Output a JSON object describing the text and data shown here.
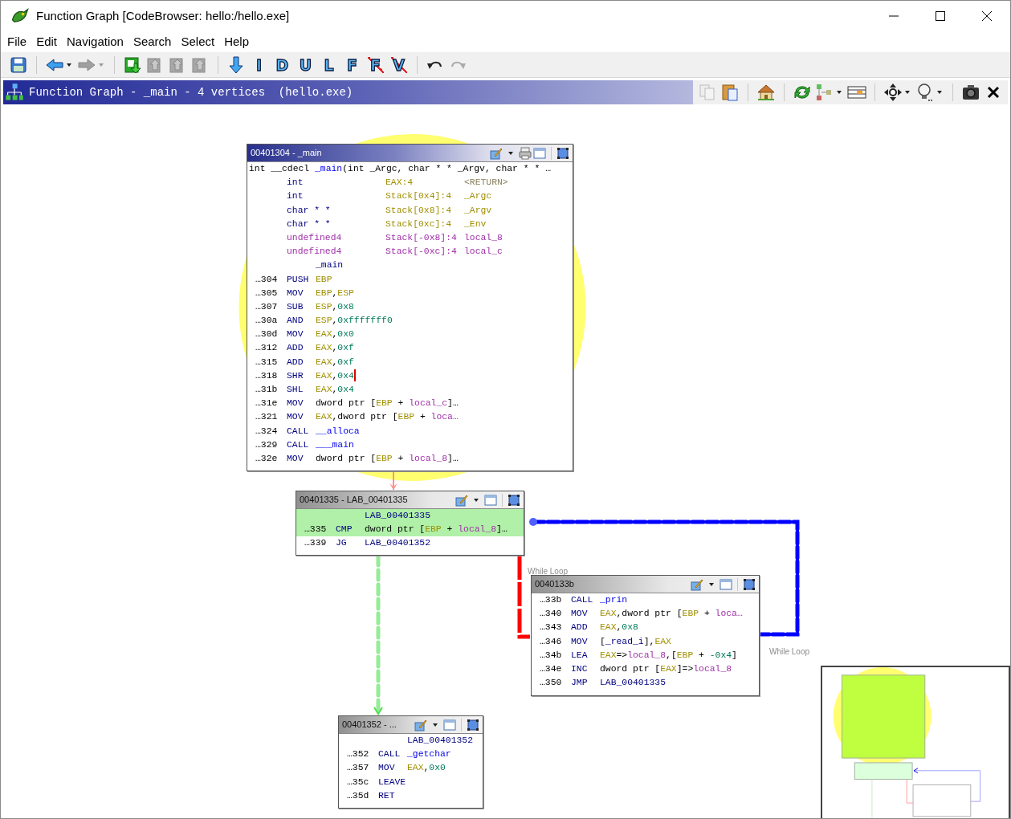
{
  "window": {
    "title": "Function Graph [CodeBrowser: hello:/hello.exe]"
  },
  "menu": [
    "File",
    "Edit",
    "Navigation",
    "Search",
    "Select",
    "Help"
  ],
  "toolbar": {
    "letter_buttons": [
      {
        "label": "I",
        "crossed": false
      },
      {
        "label": "D",
        "crossed": false
      },
      {
        "label": "U",
        "crossed": false
      },
      {
        "label": "L",
        "crossed": false
      },
      {
        "label": "F",
        "crossed": false
      },
      {
        "label": "F",
        "crossed": true
      },
      {
        "label": "V",
        "crossed": true
      }
    ]
  },
  "panel": {
    "title": "Function Graph - _main - 4 vertices  (hello.exe)"
  },
  "blocks": [
    {
      "title": "00401304 - _main",
      "focused": true,
      "lines": [
        {
          "kind": "signature",
          "tokens": [
            {
              "kind": "text",
              "text": "int __cdecl "
            },
            {
              "kind": "func",
              "text": "_main"
            },
            {
              "kind": "text",
              "text": "(int _Argc, char * * _Argv, char * * …"
            }
          ]
        },
        {
          "kind": "return_param",
          "type": "int",
          "storage": "EAX:4",
          "name": "<RETURN>"
        },
        {
          "kind": "param",
          "type": "int",
          "storage": "Stack[0x4]:4",
          "name": "_Argc"
        },
        {
          "kind": "param",
          "type": "char * *",
          "storage": "Stack[0x8]:4",
          "name": "_Argv"
        },
        {
          "kind": "param",
          "type": "char * *",
          "storage": "Stack[0xc]:4",
          "name": "_Env"
        },
        {
          "kind": "local",
          "type": "undefined4",
          "storage": "Stack[-0x8]:4",
          "name": "local_8"
        },
        {
          "kind": "local",
          "type": "undefined4",
          "storage": "Stack[-0xc]:4",
          "name": "local_c"
        },
        {
          "kind": "label",
          "text": "_main"
        },
        {
          "kind": "instr",
          "addr": "…304",
          "mnemonic": "PUSH",
          "ops": [
            {
              "kind": "reg",
              "text": "EBP"
            }
          ]
        },
        {
          "kind": "instr",
          "addr": "…305",
          "mnemonic": "MOV",
          "ops": [
            {
              "kind": "reg",
              "text": "EBP"
            },
            {
              "kind": "text",
              "text": ","
            },
            {
              "kind": "reg",
              "text": "ESP"
            }
          ]
        },
        {
          "kind": "instr",
          "addr": "…307",
          "mnemonic": "SUB",
          "ops": [
            {
              "kind": "reg",
              "text": "ESP"
            },
            {
              "kind": "text",
              "text": ","
            },
            {
              "kind": "num",
              "text": "0x8"
            }
          ]
        },
        {
          "kind": "instr",
          "addr": "…30a",
          "mnemonic": "AND",
          "ops": [
            {
              "kind": "reg",
              "text": "ESP"
            },
            {
              "kind": "text",
              "text": ","
            },
            {
              "kind": "num",
              "text": "0xfffffff0"
            }
          ]
        },
        {
          "kind": "instr",
          "addr": "…30d",
          "mnemonic": "MOV",
          "ops": [
            {
              "kind": "reg",
              "text": "EAX"
            },
            {
              "kind": "text",
              "text": ","
            },
            {
              "kind": "num",
              "text": "0x0"
            }
          ]
        },
        {
          "kind": "instr",
          "addr": "…312",
          "mnemonic": "ADD",
          "ops": [
            {
              "kind": "reg",
              "text": "EAX"
            },
            {
              "kind": "text",
              "text": ","
            },
            {
              "kind": "num",
              "text": "0xf"
            }
          ]
        },
        {
          "kind": "instr",
          "addr": "…315",
          "mnemonic": "ADD",
          "ops": [
            {
              "kind": "reg",
              "text": "EAX"
            },
            {
              "kind": "text",
              "text": ","
            },
            {
              "kind": "num",
              "text": "0xf"
            }
          ]
        },
        {
          "kind": "instr",
          "addr": "…318",
          "mnemonic": "SHR",
          "ops": [
            {
              "kind": "reg",
              "text": "EAX"
            },
            {
              "kind": "text",
              "text": ","
            },
            {
              "kind": "num",
              "text": "0x4"
            }
          ],
          "cursor": true
        },
        {
          "kind": "instr",
          "addr": "…31b",
          "mnemonic": "SHL",
          "ops": [
            {
              "kind": "reg",
              "text": "EAX"
            },
            {
              "kind": "text",
              "text": ","
            },
            {
              "kind": "num",
              "text": "0x4"
            }
          ]
        },
        {
          "kind": "instr",
          "addr": "…31e",
          "mnemonic": "MOV",
          "ops": [
            {
              "kind": "text",
              "text": "dword ptr ["
            },
            {
              "kind": "reg",
              "text": "EBP"
            },
            {
              "kind": "text",
              "text": " + "
            },
            {
              "kind": "var",
              "text": "local_c"
            },
            {
              "kind": "text",
              "text": "]…"
            }
          ]
        },
        {
          "kind": "instr",
          "addr": "…321",
          "mnemonic": "MOV",
          "ops": [
            {
              "kind": "reg",
              "text": "EAX"
            },
            {
              "kind": "text",
              "text": ",dword ptr ["
            },
            {
              "kind": "reg",
              "text": "EBP"
            },
            {
              "kind": "text",
              "text": " + "
            },
            {
              "kind": "var",
              "text": "loca…"
            }
          ]
        },
        {
          "kind": "instr",
          "addr": "…324",
          "mnemonic": "CALL",
          "ops": [
            {
              "kind": "func",
              "text": "__alloca"
            }
          ]
        },
        {
          "kind": "instr",
          "addr": "…329",
          "mnemonic": "CALL",
          "ops": [
            {
              "kind": "func",
              "text": "___main"
            }
          ]
        },
        {
          "kind": "instr",
          "addr": "…32e",
          "mnemonic": "MOV",
          "ops": [
            {
              "kind": "text",
              "text": "dword ptr ["
            },
            {
              "kind": "reg",
              "text": "EBP"
            },
            {
              "kind": "text",
              "text": " + "
            },
            {
              "kind": "var",
              "text": "local_8"
            },
            {
              "kind": "text",
              "text": "]…"
            }
          ]
        }
      ]
    },
    {
      "title": "00401335 - LAB_00401335",
      "focused": false,
      "lines": [
        {
          "kind": "label",
          "text": "LAB_00401335",
          "highlighted": true
        },
        {
          "kind": "instr",
          "addr": "…335",
          "mnemonic": "CMP",
          "ops": [
            {
              "kind": "text",
              "text": "dword ptr ["
            },
            {
              "kind": "reg",
              "text": "EBP"
            },
            {
              "kind": "text",
              "text": " + "
            },
            {
              "kind": "var",
              "text": "local_8"
            },
            {
              "kind": "text",
              "text": "]…"
            }
          ],
          "highlighted": true
        },
        {
          "kind": "instr",
          "addr": "…339",
          "mnemonic": "JG",
          "ops": [
            {
              "kind": "label",
              "text": "LAB_00401352"
            }
          ],
          "highlighted": false
        }
      ]
    },
    {
      "title": "0040133b",
      "focused": false,
      "lines": [
        {
          "kind": "instr",
          "addr": "…33b",
          "mnemonic": "CALL",
          "ops": [
            {
              "kind": "func",
              "text": "_prin"
            }
          ]
        },
        {
          "kind": "instr",
          "addr": "…340",
          "mnemonic": "MOV",
          "ops": [
            {
              "kind": "reg",
              "text": "EAX"
            },
            {
              "kind": "text",
              "text": ",dword ptr ["
            },
            {
              "kind": "reg",
              "text": "EBP"
            },
            {
              "kind": "text",
              "text": " + "
            },
            {
              "kind": "var",
              "text": "loca…"
            }
          ]
        },
        {
          "kind": "instr",
          "addr": "…343",
          "mnemonic": "ADD",
          "ops": [
            {
              "kind": "reg",
              "text": "EAX"
            },
            {
              "kind": "text",
              "text": ","
            },
            {
              "kind": "num",
              "text": "0x8"
            }
          ]
        },
        {
          "kind": "instr",
          "addr": "…346",
          "mnemonic": "MOV",
          "ops": [
            {
              "kind": "text",
              "text": "["
            },
            {
              "kind": "label",
              "text": "_read_i"
            },
            {
              "kind": "text",
              "text": "],"
            },
            {
              "kind": "reg",
              "text": "EAX"
            }
          ]
        },
        {
          "kind": "instr",
          "addr": "…34b",
          "mnemonic": "LEA",
          "ops": [
            {
              "kind": "reg",
              "text": "EAX"
            },
            {
              "kind": "text",
              "text": "=>"
            },
            {
              "kind": "var",
              "text": "local_8"
            },
            {
              "kind": "text",
              "text": ",["
            },
            {
              "kind": "reg",
              "text": "EBP"
            },
            {
              "kind": "text",
              "text": " + "
            },
            {
              "kind": "num",
              "text": "-0x4"
            },
            {
              "kind": "text",
              "text": "]"
            }
          ]
        },
        {
          "kind": "instr",
          "addr": "…34e",
          "mnemonic": "INC",
          "ops": [
            {
              "kind": "text",
              "text": "dword ptr ["
            },
            {
              "kind": "reg",
              "text": "EAX"
            },
            {
              "kind": "text",
              "text": "]=>"
            },
            {
              "kind": "var",
              "text": "local_8"
            }
          ]
        },
        {
          "kind": "instr",
          "addr": "…350",
          "mnemonic": "JMP",
          "ops": [
            {
              "kind": "label",
              "text": "LAB_00401335"
            }
          ]
        }
      ]
    },
    {
      "title": "00401352 - ...",
      "focused": false,
      "lines": [
        {
          "kind": "label",
          "text": "LAB_00401352"
        },
        {
          "kind": "instr",
          "addr": "…352",
          "mnemonic": "CALL",
          "ops": [
            {
              "kind": "func",
              "text": "_getchar"
            }
          ]
        },
        {
          "kind": "instr",
          "addr": "…357",
          "mnemonic": "MOV",
          "ops": [
            {
              "kind": "reg",
              "text": "EAX"
            },
            {
              "kind": "text",
              "text": ","
            },
            {
              "kind": "num",
              "text": "0x0"
            }
          ]
        },
        {
          "kind": "instr",
          "addr": "…35c",
          "mnemonic": "LEAVE"
        },
        {
          "kind": "instr",
          "addr": "…35d",
          "mnemonic": "RET"
        }
      ]
    }
  ],
  "edges": [
    {
      "kind": "fallthrough"
    },
    {
      "kind": "loop",
      "label": "While Loop"
    },
    {
      "kind": "jump_false",
      "label": "While Loop"
    },
    {
      "kind": "jump_true"
    }
  ]
}
